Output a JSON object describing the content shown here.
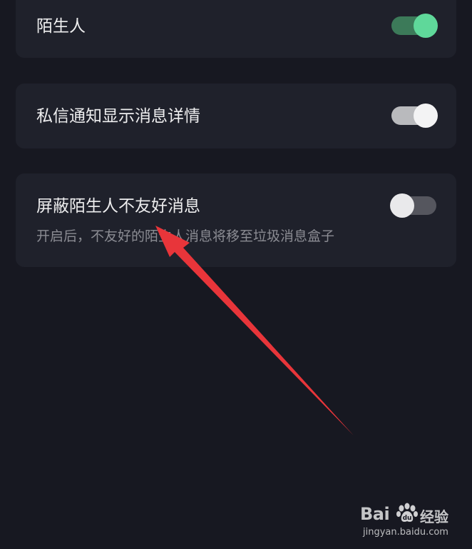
{
  "settings": [
    {
      "title": "陌生人",
      "subtitle": "",
      "toggle_state": "on",
      "toggle_color": "#5fd89a"
    },
    {
      "title": "私信通知显示消息详情",
      "subtitle": "",
      "toggle_state": "on",
      "toggle_color": "#f3f3f4"
    },
    {
      "title": "屏蔽陌生人不友好消息",
      "subtitle": "开启后，不友好的陌生人消息将移至垃圾消息盒子",
      "toggle_state": "off",
      "toggle_color": "#55565e"
    }
  ],
  "annotation": {
    "type": "arrow",
    "color": "#e8353a",
    "points_to": "屏蔽陌生人不友好消息"
  },
  "watermark": {
    "brand_left": "Bai",
    "brand_right": "经验",
    "url": "jingyan.baidu.com"
  },
  "colors": {
    "background": "#171821",
    "card": "#1f212b",
    "text_primary": "#eeeeef",
    "text_secondary": "#8b8c93"
  }
}
